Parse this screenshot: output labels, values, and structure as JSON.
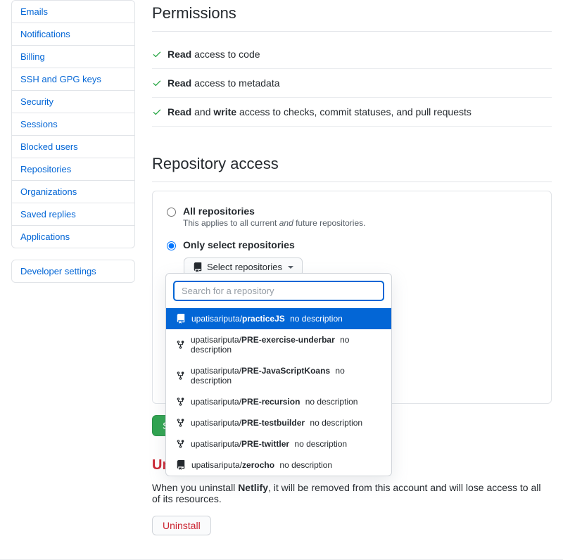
{
  "sidebar": {
    "items": [
      {
        "label": "Emails"
      },
      {
        "label": "Notifications"
      },
      {
        "label": "Billing"
      },
      {
        "label": "SSH and GPG keys"
      },
      {
        "label": "Security"
      },
      {
        "label": "Sessions"
      },
      {
        "label": "Blocked users"
      },
      {
        "label": "Repositories"
      },
      {
        "label": "Organizations"
      },
      {
        "label": "Saved replies"
      },
      {
        "label": "Applications"
      }
    ],
    "dev": {
      "label": "Developer settings"
    }
  },
  "permissions": {
    "title": "Permissions",
    "rows": [
      {
        "bold": "Read",
        "rest": " access to code"
      },
      {
        "bold": "Read",
        "rest": " access to metadata"
      },
      {
        "bold": "Read",
        "mid": " and ",
        "bold2": "write",
        "rest": " access to checks, commit statuses, and pull requests"
      }
    ]
  },
  "repo": {
    "title": "Repository access",
    "all_label": "All repositories",
    "all_help_a": "This applies to all current ",
    "all_help_i": "and",
    "all_help_b": " future repositories.",
    "only_label": "Only select repositories",
    "select_btn": "Select repositories",
    "search_placeholder": "Search for a repository",
    "list": [
      {
        "owner": "upatisariputa/",
        "name": "practiceJS",
        "desc": "no description",
        "type": "repo"
      },
      {
        "owner": "upatisariputa/",
        "name": "PRE-exercise-underbar",
        "desc": "no description",
        "type": "fork"
      },
      {
        "owner": "upatisariputa/",
        "name": "PRE-JavaScriptKoans",
        "desc": "no description",
        "type": "fork"
      },
      {
        "owner": "upatisariputa/",
        "name": "PRE-recursion",
        "desc": "no description",
        "type": "fork"
      },
      {
        "owner": "upatisariputa/",
        "name": "PRE-testbuilder",
        "desc": "no description",
        "type": "fork"
      },
      {
        "owner": "upatisariputa/",
        "name": "PRE-twittler",
        "desc": "no description",
        "type": "fork"
      },
      {
        "owner": "upatisariputa/",
        "name": "zerocho",
        "desc": "no description",
        "type": "repo"
      }
    ],
    "save": "Save"
  },
  "uninstall": {
    "title_partial": "Unin",
    "app_name": "Netlify",
    "text_a": "When you uninstall ",
    "text_b": ", it will be removed from this account and will lose access to all of its resources.",
    "btn": "Uninstall"
  }
}
